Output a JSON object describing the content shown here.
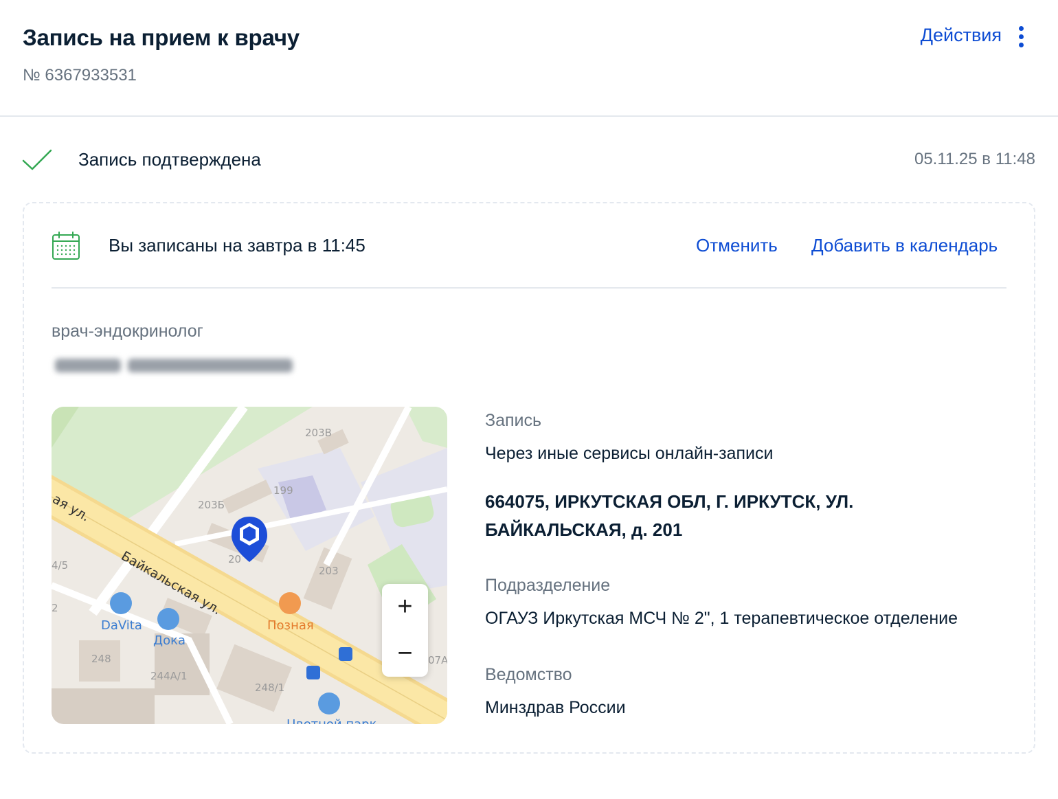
{
  "header": {
    "title": "Запись на прием к врачу",
    "number": "№ 6367933531",
    "actions_label": "Действия"
  },
  "status": {
    "text": "Запись подтверждена",
    "date": "05.11.25 в 11:48",
    "color": "#34a853"
  },
  "appointment": {
    "text": "Вы записаны на завтра в 11:45",
    "cancel_label": "Отменить",
    "add_calendar_label": "Добавить в календарь"
  },
  "doctor": {
    "specialty": "врач-эндокринолог",
    "name_hidden": true
  },
  "map": {
    "street": "Байкальская ул.",
    "street_partial": "ая ул.",
    "buildings": [
      "203В",
      "203Б",
      "199",
      "20",
      "203",
      "4/5",
      "2",
      "248",
      "244А/1",
      "248/1",
      "07А"
    ],
    "places": [
      "DaVita",
      "Дока",
      "Позная",
      "Цветной парк"
    ],
    "zoom_in": "+",
    "zoom_out": "−"
  },
  "details": {
    "record_label": "Запись",
    "record_value": "Через иные сервисы онлайн-записи",
    "address_line1": "664075, ИРКУТСКАЯ ОБЛ, Г. ИРКУТСК, УЛ.",
    "address_line2": "БАЙКАЛЬСКАЯ, д. 201",
    "division_label": "Подразделение",
    "division_value": "ОГАУЗ Иркутская МСЧ № 2\", 1 терапевтическое отделение",
    "agency_label": "Ведомство",
    "agency_value": "Минздрав России"
  },
  "colors": {
    "link": "#0d4cd3",
    "text": "#0b1f33",
    "muted": "#66727f",
    "calendar_icon": "#34a853"
  }
}
